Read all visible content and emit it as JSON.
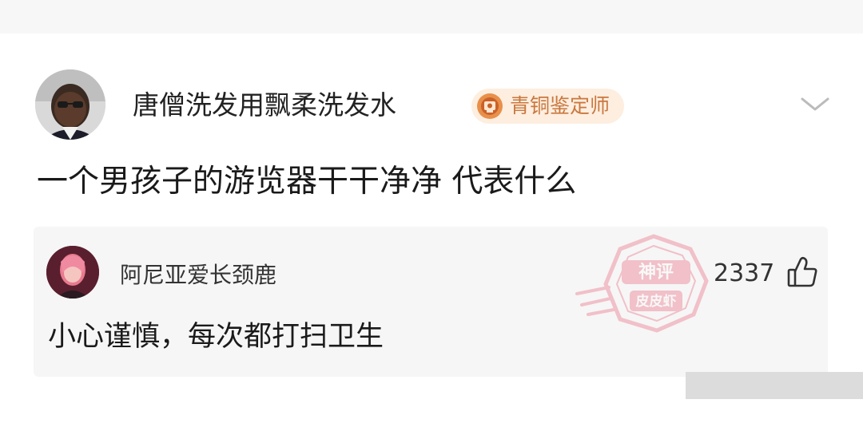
{
  "post": {
    "author": {
      "name": "唐僧洗发用飘柔洗发水",
      "badge_label": "青铜鉴定师",
      "badge_icon": "bronze-appraiser-icon",
      "badge_color": "#c9783e"
    },
    "text": "一个男孩子的游览器干干净净 代表什么",
    "menu_icon": "chevron-down-icon"
  },
  "reply": {
    "author": "阿尼亚爱长颈鹿",
    "likes": "2337",
    "like_icon": "thumbs-up-icon",
    "text": "小心谨慎，每次都打扫卫生"
  },
  "watermark": {
    "lines": [
      "神评",
      "皮皮虾"
    ],
    "color": "#e8506a"
  }
}
